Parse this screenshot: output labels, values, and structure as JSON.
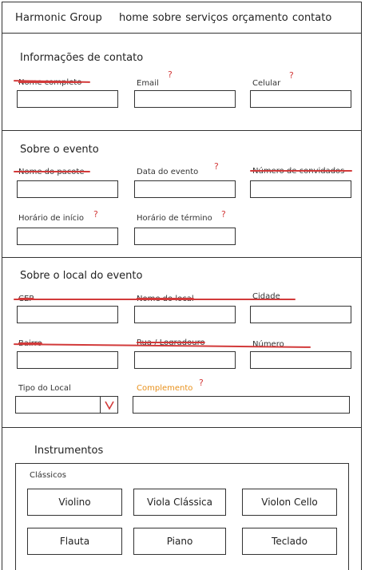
{
  "header": {
    "brand": "Harmonic Group",
    "nav": [
      "home",
      "sobre",
      "serviços",
      "orçamento",
      "contato"
    ]
  },
  "sections": {
    "contato": {
      "title": "Informações de contato",
      "fields": {
        "nome": "Nome completo",
        "email": "Email",
        "celular": "Celular"
      }
    },
    "evento": {
      "title": "Sobre o evento",
      "fields": {
        "pacote": "Nome do pacote",
        "data": "Data do evento",
        "convidados": "Número de convidados",
        "inicio": "Horário de início",
        "termino": "Horário de término"
      }
    },
    "local": {
      "title": "Sobre o local do evento",
      "fields": {
        "cep": "CEP",
        "nome_local": "Nome do local",
        "cidade": "Cidade",
        "bairro": "Bairro",
        "rua": "Rua / Logradouro",
        "numero": "Número",
        "tipo": "Tipo do Local",
        "complemento": "Complemento"
      }
    },
    "instrumentos": {
      "title": "Instrumentos",
      "group": "Clássicos",
      "items": [
        "Violino",
        "Viola Clássica",
        "Violon Cello",
        "Flauta",
        "Piano",
        "Teclado"
      ]
    }
  },
  "question_mark": "?",
  "colors": {
    "annotation_red": "#d23a3a",
    "optional_orange": "#e8901a",
    "stroke": "#333333"
  }
}
